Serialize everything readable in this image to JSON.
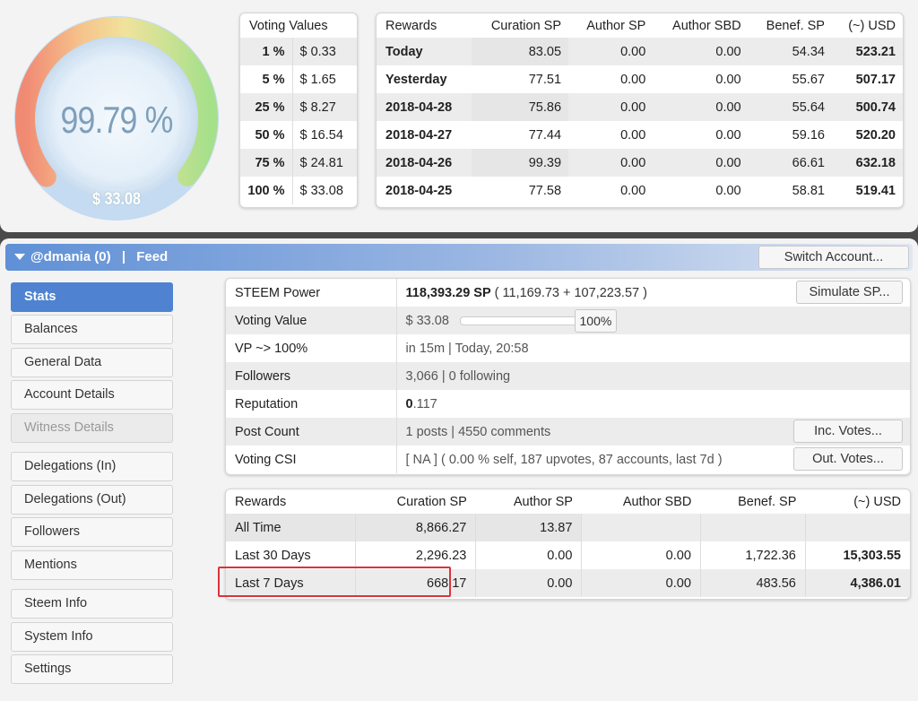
{
  "gauge": {
    "percent_text": "99.79 %",
    "usd_text": "$ 33.08",
    "fill_fraction": 0.9979
  },
  "voting_values": {
    "header": "Voting Values",
    "rows": [
      {
        "pct": "1 %",
        "usd": "$ 0.33"
      },
      {
        "pct": "5 %",
        "usd": "$ 1.65"
      },
      {
        "pct": "25 %",
        "usd": "$ 8.27"
      },
      {
        "pct": "50 %",
        "usd": "$ 16.54"
      },
      {
        "pct": "75 %",
        "usd": "$ 24.81"
      },
      {
        "pct": "100 %",
        "usd": "$ 33.08"
      }
    ]
  },
  "daily_rewards": {
    "headers": [
      "Rewards",
      "Curation SP",
      "Author SP",
      "Author SBD",
      "Benef. SP",
      "(~) USD"
    ],
    "rows": [
      [
        "Today",
        "83.05",
        "0.00",
        "0.00",
        "54.34",
        "523.21"
      ],
      [
        "Yesterday",
        "77.51",
        "0.00",
        "0.00",
        "55.67",
        "507.17"
      ],
      [
        "2018-04-28",
        "75.86",
        "0.00",
        "0.00",
        "55.64",
        "500.74"
      ],
      [
        "2018-04-27",
        "77.44",
        "0.00",
        "0.00",
        "59.16",
        "520.20"
      ],
      [
        "2018-04-26",
        "99.39",
        "0.00",
        "0.00",
        "66.61",
        "632.18"
      ],
      [
        "2018-04-25",
        "77.58",
        "0.00",
        "0.00",
        "58.81",
        "519.41"
      ]
    ]
  },
  "header": {
    "account_label": "@dmania (0)",
    "separator": "|",
    "feed_label": "Feed",
    "switch_label": "Switch Account..."
  },
  "sidebar": {
    "items": [
      {
        "label": "Stats"
      },
      {
        "label": "Balances"
      },
      {
        "label": "General Data"
      },
      {
        "label": "Account Details"
      },
      {
        "label": "Witness Details"
      },
      {
        "label": "Delegations (In)"
      },
      {
        "label": "Delegations (Out)"
      },
      {
        "label": "Followers"
      },
      {
        "label": "Mentions"
      },
      {
        "label": "Steem Info"
      },
      {
        "label": "System Info"
      },
      {
        "label": "Settings"
      }
    ]
  },
  "stats": {
    "steem_power": {
      "label": "STEEM Power",
      "value_bold": "118,393.29 SP",
      "value_rest": " ( 11,169.73 + 107,223.57 )",
      "button": "Simulate SP..."
    },
    "voting_value": {
      "label": "Voting Value",
      "value": "$ 33.08",
      "slider_label": "100%",
      "slider_fraction": 1.0
    },
    "vp": {
      "label": "VP ~> 100%",
      "value": "in 15m | Today, 20:58"
    },
    "followers": {
      "label": "Followers",
      "value": "3,066 | 0 following"
    },
    "reputation": {
      "label": "Reputation",
      "value_bold": "0",
      "value_rest": ".117"
    },
    "post_count": {
      "label": "Post Count",
      "value": "1 posts | 4550 comments",
      "button": "Inc. Votes..."
    },
    "voting_csi": {
      "label": "Voting CSI",
      "value": "[ NA ] ( 0.00 % self, 187 upvotes, 87 accounts, last 7d )",
      "button": "Out. Votes..."
    }
  },
  "summary_rewards": {
    "headers": [
      "Rewards",
      "Curation SP",
      "Author SP",
      "Author SBD",
      "Benef. SP",
      "(~) USD"
    ],
    "rows": [
      [
        "All Time",
        "8,866.27",
        "13.87",
        "",
        "",
        ""
      ],
      [
        "Last 30 Days",
        "2,296.23",
        "0.00",
        "0.00",
        "1,722.36",
        "15,303.55"
      ],
      [
        "Last 7 Days",
        "668.17",
        "0.00",
        "0.00",
        "483.56",
        "4,386.01"
      ]
    ]
  },
  "colors": {
    "accent": "#4f83d1",
    "highlight": "#d9343a",
    "gauge_text": "#7f9fba"
  }
}
